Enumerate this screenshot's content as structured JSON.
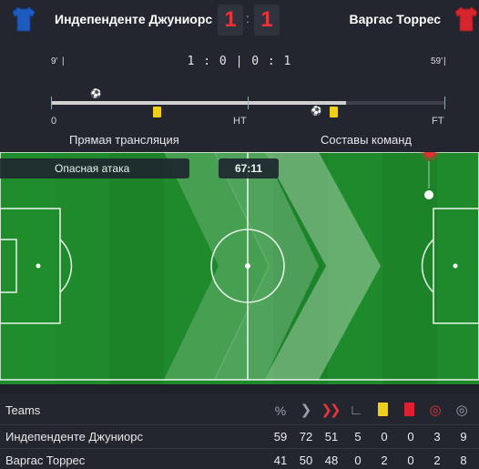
{
  "header": {
    "home_team": "Индепенденте Джуниорс",
    "away_team": "Варгас Торрес",
    "home_score": "1",
    "away_score": "1",
    "score_separator": ":",
    "home_jersey_color": "#1e5bbf",
    "away_jersey_color": "#d6252c"
  },
  "timeline": {
    "left_event_minute": "9'",
    "right_event_minute": "59'",
    "period_score": "1 : 0 | 0 : 1",
    "start_label": "0",
    "half_label": "HT",
    "end_label": "FT",
    "progress_fraction": 0.75,
    "events": [
      {
        "type": "goal-icon",
        "team": "home",
        "minute": 9
      },
      {
        "type": "yellow-card",
        "team": "away",
        "minute": 23
      },
      {
        "type": "goal-icon",
        "team": "away",
        "minute": 59
      },
      {
        "type": "yellow-card",
        "team": "away",
        "minute": 64
      }
    ]
  },
  "tabs": {
    "live": "Прямая трансляция",
    "lineups": "Составы команд"
  },
  "pitch": {
    "event_label": "Опасная атака",
    "clock": "67:11",
    "grass_color": "#1f8a2c",
    "attack_direction": "right"
  },
  "stats": {
    "header_label": "Teams",
    "column_icons": [
      "percent-icon",
      "chevron-right-icon",
      "double-chevron-icon",
      "corner-icon",
      "yellow-card-icon",
      "red-card-icon",
      "target-icon",
      "off-target-icon"
    ],
    "rows": [
      {
        "team": "Индепенденте Джуниорс",
        "values": [
          "59",
          "72",
          "51",
          "5",
          "0",
          "0",
          "3",
          "9"
        ]
      },
      {
        "team": "Варгас Торрес",
        "values": [
          "41",
          "50",
          "48",
          "0",
          "2",
          "0",
          "2",
          "8"
        ]
      }
    ]
  }
}
